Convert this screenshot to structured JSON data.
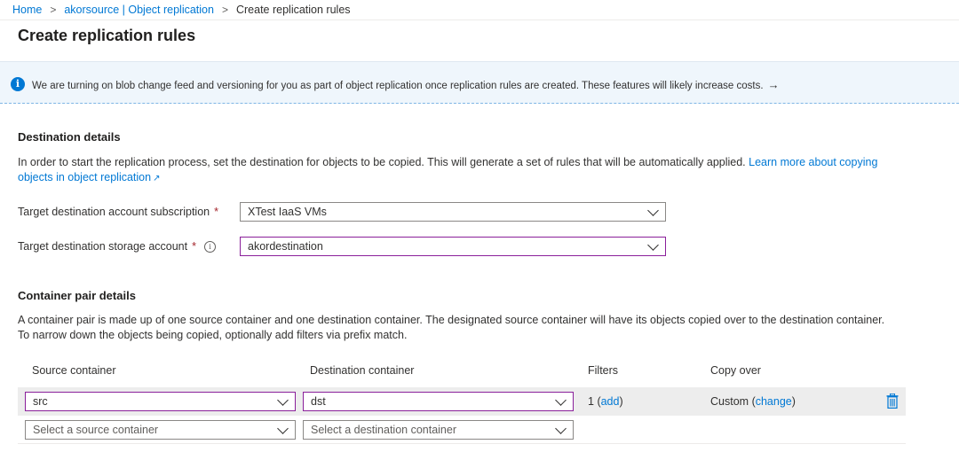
{
  "breadcrumb": {
    "home": "Home",
    "account": "akorsource | Object replication",
    "current": "Create replication rules"
  },
  "page": {
    "title": "Create replication rules"
  },
  "banner": {
    "icon": "info-icon",
    "text": "We are turning on blob change feed and versioning for you as part of object replication once replication rules are created. These features will likely increase costs.",
    "arrow": "→"
  },
  "destination": {
    "title": "Destination details",
    "description": "In order to start the replication process, set the destination for objects to be copied. This will generate a set of rules that will be automatically applied.",
    "learn_more": "Learn more about copying objects in object replication",
    "subscription_label": "Target destination account subscription",
    "subscription_value": "XTest IaaS VMs",
    "storage_label": "Target destination storage account",
    "storage_value": "akordestination",
    "required_marker": "*"
  },
  "container_pair": {
    "title": "Container pair details",
    "description": "A container pair is made up of one source container and one destination container. The designated source container will have its objects copied over to the destination container. To narrow down the objects being copied, optionally add filters via prefix match.",
    "columns": [
      "Source container",
      "Destination container",
      "Filters",
      "Copy over"
    ],
    "rows": [
      {
        "source": "src",
        "destination": "dst",
        "filters_count": "1",
        "filters_action": "add",
        "copy_over": "Custom",
        "copy_over_action": "change"
      }
    ],
    "new_row": {
      "source_placeholder": "Select a source container",
      "destination_placeholder": "Select a destination container"
    }
  },
  "colors": {
    "accent": "#0078d4",
    "focus_border": "#8a1f9a",
    "required": "#a4262c",
    "banner_bg": "#eff6fc"
  }
}
